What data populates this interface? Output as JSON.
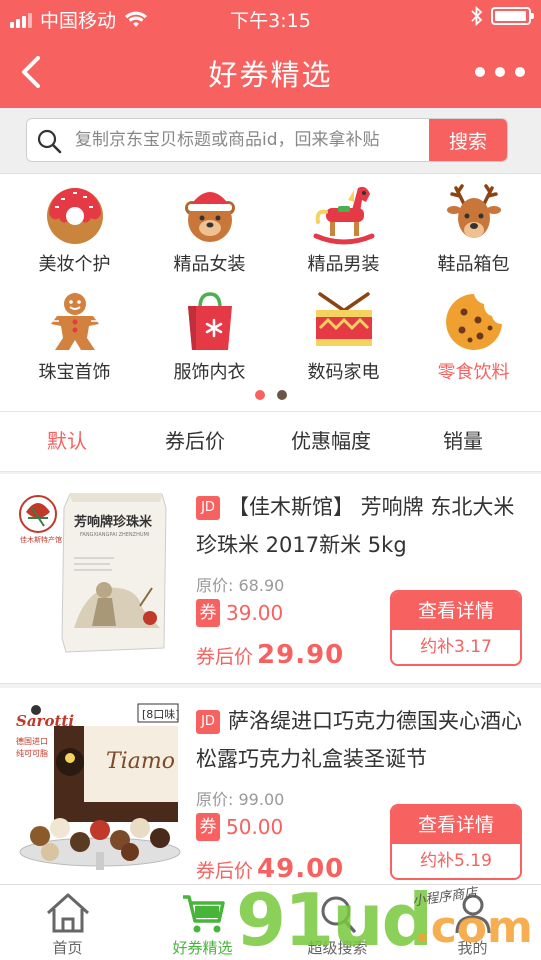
{
  "status_bar": {
    "carrier": "中国移动",
    "time": "下午3:15"
  },
  "nav": {
    "title": "好券精选"
  },
  "search": {
    "placeholder": "复制京东宝贝标题或商品id，回来拿补贴",
    "button_label": "搜索"
  },
  "categories": [
    {
      "label": "美妆个护",
      "icon": "donut-icon"
    },
    {
      "label": "精品女装",
      "icon": "bear-santa-icon"
    },
    {
      "label": "精品男装",
      "icon": "rocking-horse-icon"
    },
    {
      "label": "鞋品箱包",
      "icon": "reindeer-icon"
    },
    {
      "label": "珠宝首饰",
      "icon": "gingerbread-icon"
    },
    {
      "label": "服饰内衣",
      "icon": "shopping-bag-icon"
    },
    {
      "label": "数码家电",
      "icon": "drum-icon"
    },
    {
      "label": "零食饮料",
      "icon": "cookie-icon"
    }
  ],
  "carousel": {
    "page": 1,
    "pages": 2
  },
  "sort_tabs": [
    "默认",
    "券后价",
    "优惠幅度",
    "销量"
  ],
  "active_tab": "默认",
  "products": [
    {
      "badge": "JD",
      "title": "【佳木斯馆】 芳响牌 东北大米 珍珠米 2017新米 5kg",
      "original_price_label": "原价:",
      "original_price": "68.90",
      "coupon_label": "券",
      "coupon_value": "39.00",
      "after_label": "券后价",
      "after_price": "29.90",
      "detail_label": "查看详情",
      "subsidy": "约补3.17",
      "image": {
        "bag_text": "芳响牌珍珠米",
        "brand_text": "佳木斯特产馆"
      }
    },
    {
      "badge": "JD",
      "title": "萨洛缇进口巧克力德国夹心酒心松露巧克力礼盒装圣诞节",
      "original_price_label": "原价:",
      "original_price": "99.00",
      "coupon_label": "券",
      "coupon_value": "50.00",
      "after_label": "券后价",
      "after_price": "49.00",
      "detail_label": "查看详情",
      "subsidy": "约补5.19",
      "image": {
        "brand": "Sarotti",
        "tag": "8口味",
        "sub": "德国进口\n纯可可脂",
        "box_text": "Tiamo"
      }
    }
  ],
  "bottom_tabs": [
    {
      "label": "首页",
      "icon": "home-icon"
    },
    {
      "label": "好券精选",
      "icon": "cart-icon"
    },
    {
      "label": "超级搜索",
      "icon": "search-icon"
    },
    {
      "label": "我的",
      "icon": "user-icon"
    }
  ],
  "watermark": {
    "main": "91ud",
    "suffix": ".com",
    "small": "小程序商店"
  },
  "colors": {
    "accent": "#f76160",
    "active_green": "#46b53a"
  }
}
